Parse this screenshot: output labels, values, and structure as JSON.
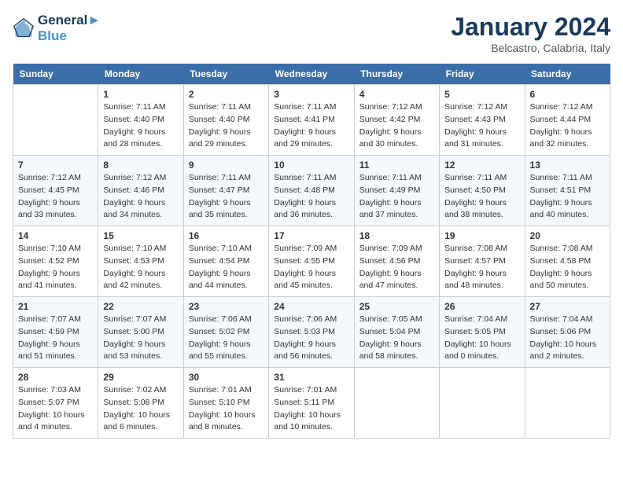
{
  "header": {
    "logo_line1": "General",
    "logo_line2": "Blue",
    "month": "January 2024",
    "location": "Belcastro, Calabria, Italy"
  },
  "days_of_week": [
    "Sunday",
    "Monday",
    "Tuesday",
    "Wednesday",
    "Thursday",
    "Friday",
    "Saturday"
  ],
  "weeks": [
    [
      {
        "num": "",
        "info": ""
      },
      {
        "num": "1",
        "info": "Sunrise: 7:11 AM\nSunset: 4:40 PM\nDaylight: 9 hours\nand 28 minutes."
      },
      {
        "num": "2",
        "info": "Sunrise: 7:11 AM\nSunset: 4:40 PM\nDaylight: 9 hours\nand 29 minutes."
      },
      {
        "num": "3",
        "info": "Sunrise: 7:11 AM\nSunset: 4:41 PM\nDaylight: 9 hours\nand 29 minutes."
      },
      {
        "num": "4",
        "info": "Sunrise: 7:12 AM\nSunset: 4:42 PM\nDaylight: 9 hours\nand 30 minutes."
      },
      {
        "num": "5",
        "info": "Sunrise: 7:12 AM\nSunset: 4:43 PM\nDaylight: 9 hours\nand 31 minutes."
      },
      {
        "num": "6",
        "info": "Sunrise: 7:12 AM\nSunset: 4:44 PM\nDaylight: 9 hours\nand 32 minutes."
      }
    ],
    [
      {
        "num": "7",
        "info": "Sunrise: 7:12 AM\nSunset: 4:45 PM\nDaylight: 9 hours\nand 33 minutes."
      },
      {
        "num": "8",
        "info": "Sunrise: 7:12 AM\nSunset: 4:46 PM\nDaylight: 9 hours\nand 34 minutes."
      },
      {
        "num": "9",
        "info": "Sunrise: 7:11 AM\nSunset: 4:47 PM\nDaylight: 9 hours\nand 35 minutes."
      },
      {
        "num": "10",
        "info": "Sunrise: 7:11 AM\nSunset: 4:48 PM\nDaylight: 9 hours\nand 36 minutes."
      },
      {
        "num": "11",
        "info": "Sunrise: 7:11 AM\nSunset: 4:49 PM\nDaylight: 9 hours\nand 37 minutes."
      },
      {
        "num": "12",
        "info": "Sunrise: 7:11 AM\nSunset: 4:50 PM\nDaylight: 9 hours\nand 38 minutes."
      },
      {
        "num": "13",
        "info": "Sunrise: 7:11 AM\nSunset: 4:51 PM\nDaylight: 9 hours\nand 40 minutes."
      }
    ],
    [
      {
        "num": "14",
        "info": "Sunrise: 7:10 AM\nSunset: 4:52 PM\nDaylight: 9 hours\nand 41 minutes."
      },
      {
        "num": "15",
        "info": "Sunrise: 7:10 AM\nSunset: 4:53 PM\nDaylight: 9 hours\nand 42 minutes."
      },
      {
        "num": "16",
        "info": "Sunrise: 7:10 AM\nSunset: 4:54 PM\nDaylight: 9 hours\nand 44 minutes."
      },
      {
        "num": "17",
        "info": "Sunrise: 7:09 AM\nSunset: 4:55 PM\nDaylight: 9 hours\nand 45 minutes."
      },
      {
        "num": "18",
        "info": "Sunrise: 7:09 AM\nSunset: 4:56 PM\nDaylight: 9 hours\nand 47 minutes."
      },
      {
        "num": "19",
        "info": "Sunrise: 7:08 AM\nSunset: 4:57 PM\nDaylight: 9 hours\nand 48 minutes."
      },
      {
        "num": "20",
        "info": "Sunrise: 7:08 AM\nSunset: 4:58 PM\nDaylight: 9 hours\nand 50 minutes."
      }
    ],
    [
      {
        "num": "21",
        "info": "Sunrise: 7:07 AM\nSunset: 4:59 PM\nDaylight: 9 hours\nand 51 minutes."
      },
      {
        "num": "22",
        "info": "Sunrise: 7:07 AM\nSunset: 5:00 PM\nDaylight: 9 hours\nand 53 minutes."
      },
      {
        "num": "23",
        "info": "Sunrise: 7:06 AM\nSunset: 5:02 PM\nDaylight: 9 hours\nand 55 minutes."
      },
      {
        "num": "24",
        "info": "Sunrise: 7:06 AM\nSunset: 5:03 PM\nDaylight: 9 hours\nand 56 minutes."
      },
      {
        "num": "25",
        "info": "Sunrise: 7:05 AM\nSunset: 5:04 PM\nDaylight: 9 hours\nand 58 minutes."
      },
      {
        "num": "26",
        "info": "Sunrise: 7:04 AM\nSunset: 5:05 PM\nDaylight: 10 hours\nand 0 minutes."
      },
      {
        "num": "27",
        "info": "Sunrise: 7:04 AM\nSunset: 5:06 PM\nDaylight: 10 hours\nand 2 minutes."
      }
    ],
    [
      {
        "num": "28",
        "info": "Sunrise: 7:03 AM\nSunset: 5:07 PM\nDaylight: 10 hours\nand 4 minutes."
      },
      {
        "num": "29",
        "info": "Sunrise: 7:02 AM\nSunset: 5:08 PM\nDaylight: 10 hours\nand 6 minutes."
      },
      {
        "num": "30",
        "info": "Sunrise: 7:01 AM\nSunset: 5:10 PM\nDaylight: 10 hours\nand 8 minutes."
      },
      {
        "num": "31",
        "info": "Sunrise: 7:01 AM\nSunset: 5:11 PM\nDaylight: 10 hours\nand 10 minutes."
      },
      {
        "num": "",
        "info": ""
      },
      {
        "num": "",
        "info": ""
      },
      {
        "num": "",
        "info": ""
      }
    ]
  ]
}
